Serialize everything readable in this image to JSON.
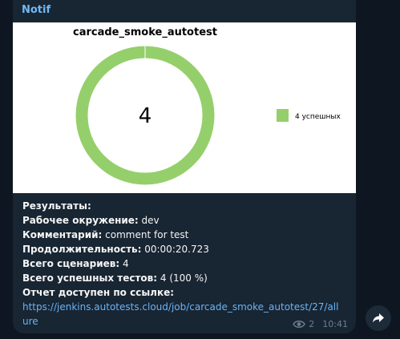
{
  "message": {
    "sender": "Notif",
    "lines": [
      {
        "label": "Результаты:",
        "value": ""
      },
      {
        "label": "Рабочее окружение:",
        "value": " dev"
      },
      {
        "label": "Комментарий:",
        "value": " comment for test"
      },
      {
        "label": "Продолжительность:",
        "value": " 00:00:20.723"
      },
      {
        "label": "Всего сценариев:",
        "value": " 4"
      },
      {
        "label": "Всего успешных тестов:",
        "value": " 4 (100 %)"
      },
      {
        "label": "Отчет доступен по ссылке:",
        "value": ""
      }
    ],
    "link": "https://jenkins.autotests.cloud/job/carcade_smoke_autotest/27/allure",
    "views": "2",
    "time": "10:41"
  },
  "icons": {
    "views": "eye-icon",
    "forward": "forward-arrow-icon"
  },
  "colors": {
    "background": "#0e1621",
    "bubble": "#182533",
    "sender": "#71baf5",
    "link": "#6ab3f3",
    "success": "#95cf6b"
  },
  "chart_data": {
    "type": "pie",
    "title": "carcade_smoke_autotest",
    "center_label": "4",
    "categories": [
      "4 успешных"
    ],
    "values": [
      4
    ],
    "legend_position": "right",
    "donut": true
  }
}
